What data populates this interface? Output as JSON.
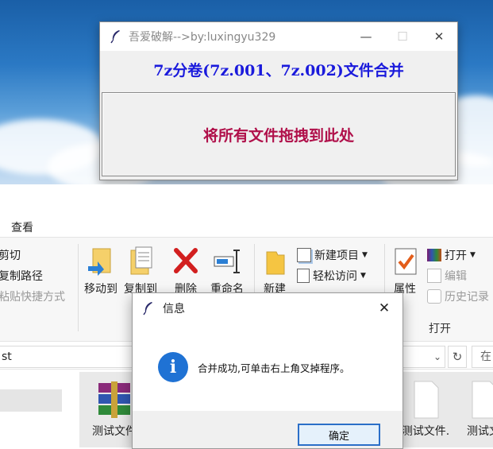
{
  "tool_window": {
    "title": "吾爱破解-->by:luxingyu329",
    "header": "7z分卷(7z.001、7z.002)文件合并",
    "dropzone_text": "将所有文件拖拽到此处",
    "minimize": "—",
    "maximize": "☐",
    "close": "✕"
  },
  "explorer": {
    "tab_view": "查看",
    "ribbon": {
      "cut": "剪切",
      "copy_path": "复制路径",
      "paste_shortcut": "粘贴快捷方式",
      "move_to": "移动到",
      "copy_to": "复制到",
      "delete": "删除",
      "rename": "重命名",
      "new_folder": "新建",
      "new_item": "新建项目",
      "easy_access": "轻松访问",
      "properties": "属性",
      "open": "打开",
      "edit": "编辑",
      "history": "历史记录",
      "group_open": "打开"
    },
    "address": {
      "path_fragment": "st",
      "search_placeholder": "在"
    },
    "files": [
      {
        "name": "测试文件"
      },
      {
        "name": "测试文件."
      },
      {
        "name": "测试文"
      }
    ]
  },
  "dialog": {
    "title": "信息",
    "message": "合并成功,可单击右上角叉掉程序。",
    "ok": "确定",
    "close": "✕"
  },
  "colors": {
    "header_blue": "#1a1adc",
    "dropzone_red": "#b0104a",
    "info_blue": "#1f72d4",
    "ok_border": "#2b6fc8"
  }
}
